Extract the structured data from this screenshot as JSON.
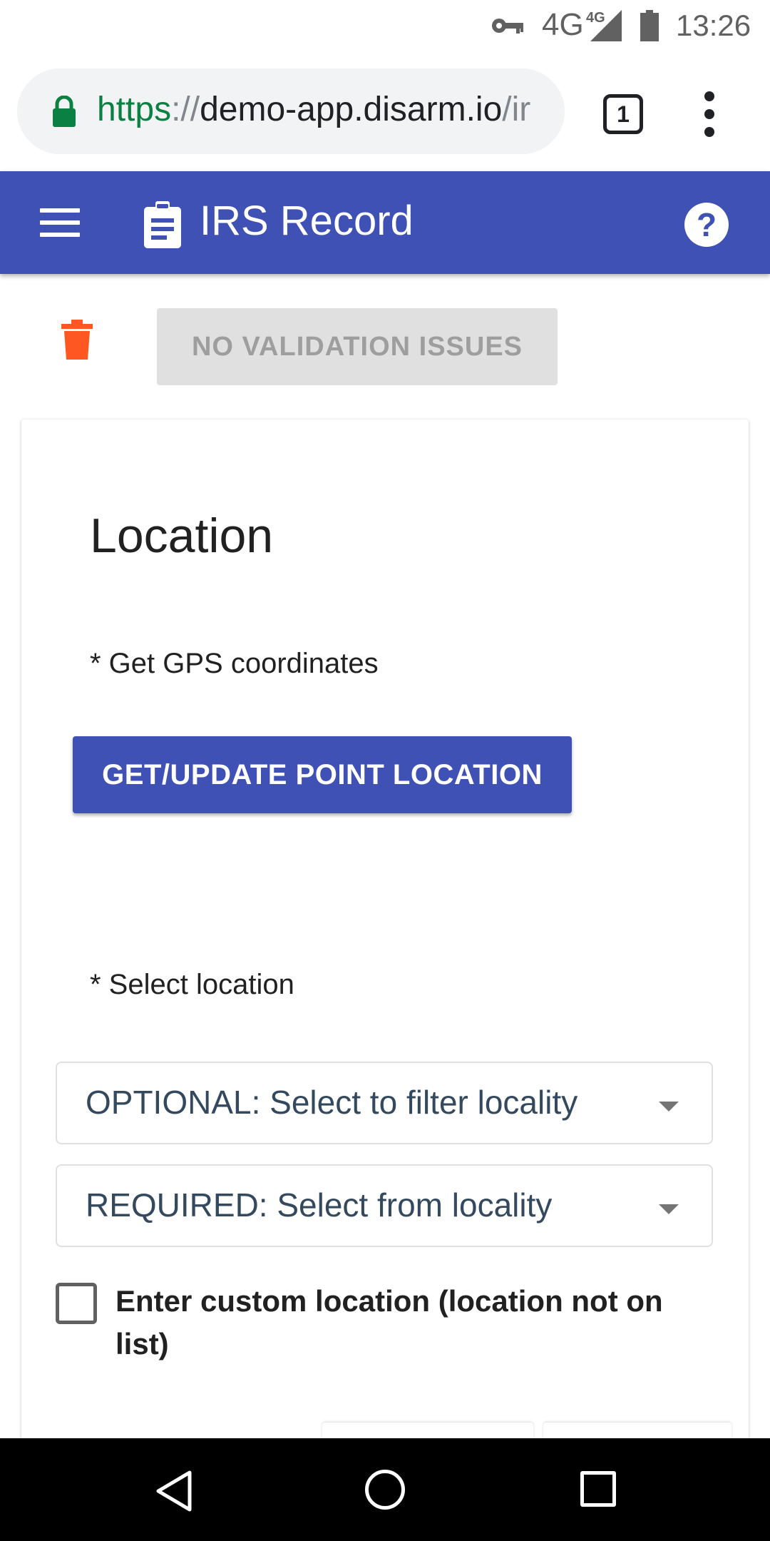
{
  "status_bar": {
    "network_label": "4G",
    "network_sup": "4G",
    "time": "13:26",
    "icons": [
      "key-icon",
      "signal-icon",
      "battery-icon"
    ]
  },
  "browser": {
    "url_scheme": "https",
    "url_separator": "://",
    "url_host": "demo-app.disarm.io",
    "url_rest": "/ir",
    "tab_count": "1",
    "icons": [
      "lock-icon",
      "overflow-menu-icon"
    ]
  },
  "toolbar": {
    "title": "IRS Record",
    "help_label": "?",
    "color": "#3f51b5",
    "icons": [
      "menu-icon",
      "clipboard-icon",
      "help-icon"
    ]
  },
  "actions": {
    "validation_label": "NO VALIDATION ISSUES",
    "trash_color": "#ff5722"
  },
  "location_section": {
    "title": "Location",
    "gps_label": "* Get GPS coordinates",
    "gps_button_label": "GET/UPDATE POINT LOCATION",
    "select_label": "* Select location",
    "filter_placeholder": "OPTIONAL: Select to filter locality",
    "locality_placeholder": "REQUIRED: Select from locality",
    "custom_location_label": "Enter custom location (location not on list)",
    "custom_location_checked": false
  },
  "nav_bar": {
    "icons": [
      "back-icon",
      "home-icon",
      "recents-icon"
    ]
  }
}
